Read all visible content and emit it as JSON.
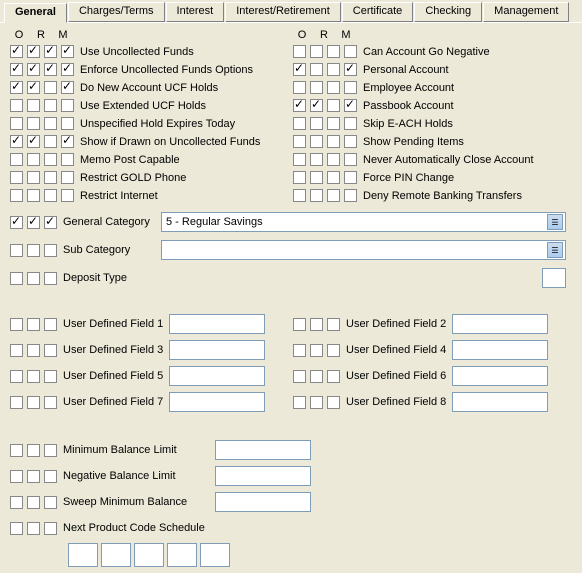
{
  "tabs": {
    "general": "General",
    "charges": "Charges/Terms",
    "interest": "Interest",
    "interest_ret": "Interest/Retirement",
    "certificate": "Certificate",
    "checking": "Checking",
    "management": "Management"
  },
  "headers": {
    "o": "O",
    "r": "R",
    "m": "M"
  },
  "left": {
    "use_uncollected": "Use Uncollected Funds",
    "enforce_ucf": "Enforce Uncollected Funds Options",
    "new_account_ucf": "Do New Account UCF Holds",
    "extended_ucf": "Use Extended UCF Holds",
    "unspecified_hold": "Unspecified Hold Expires Today",
    "show_if_drawn": "Show if Drawn on Uncollected Funds",
    "memo_post": "Memo Post Capable",
    "restrict_gold": "Restrict GOLD Phone",
    "restrict_internet": "Restrict Internet"
  },
  "right": {
    "can_neg": "Can Account Go Negative",
    "personal": "Personal Account",
    "employee": "Employee Account",
    "passbook": "Passbook Account",
    "skip_each": "Skip E-ACH Holds",
    "show_pending": "Show Pending Items",
    "never_auto_close": "Never Automatically Close Account",
    "force_pin": "Force PIN Change",
    "deny_remote": "Deny Remote Banking Transfers"
  },
  "category": {
    "general_label": "General Category",
    "general_value": "5 - Regular Savings",
    "sub_label": "Sub Category",
    "sub_value": "",
    "deposit_label": "Deposit Type"
  },
  "udf": {
    "f1": "User Defined Field 1",
    "f2": "User Defined Field 2",
    "f3": "User Defined Field 3",
    "f4": "User Defined Field 4",
    "f5": "User Defined Field 5",
    "f6": "User Defined Field 6",
    "f7": "User Defined Field 7",
    "f8": "User Defined Field 8"
  },
  "bottom": {
    "min_bal": "Minimum Balance Limit",
    "neg_bal": "Negative Balance Limit",
    "sweep_min": "Sweep Minimum Balance",
    "next_sched": "Next Product Code Schedule"
  }
}
